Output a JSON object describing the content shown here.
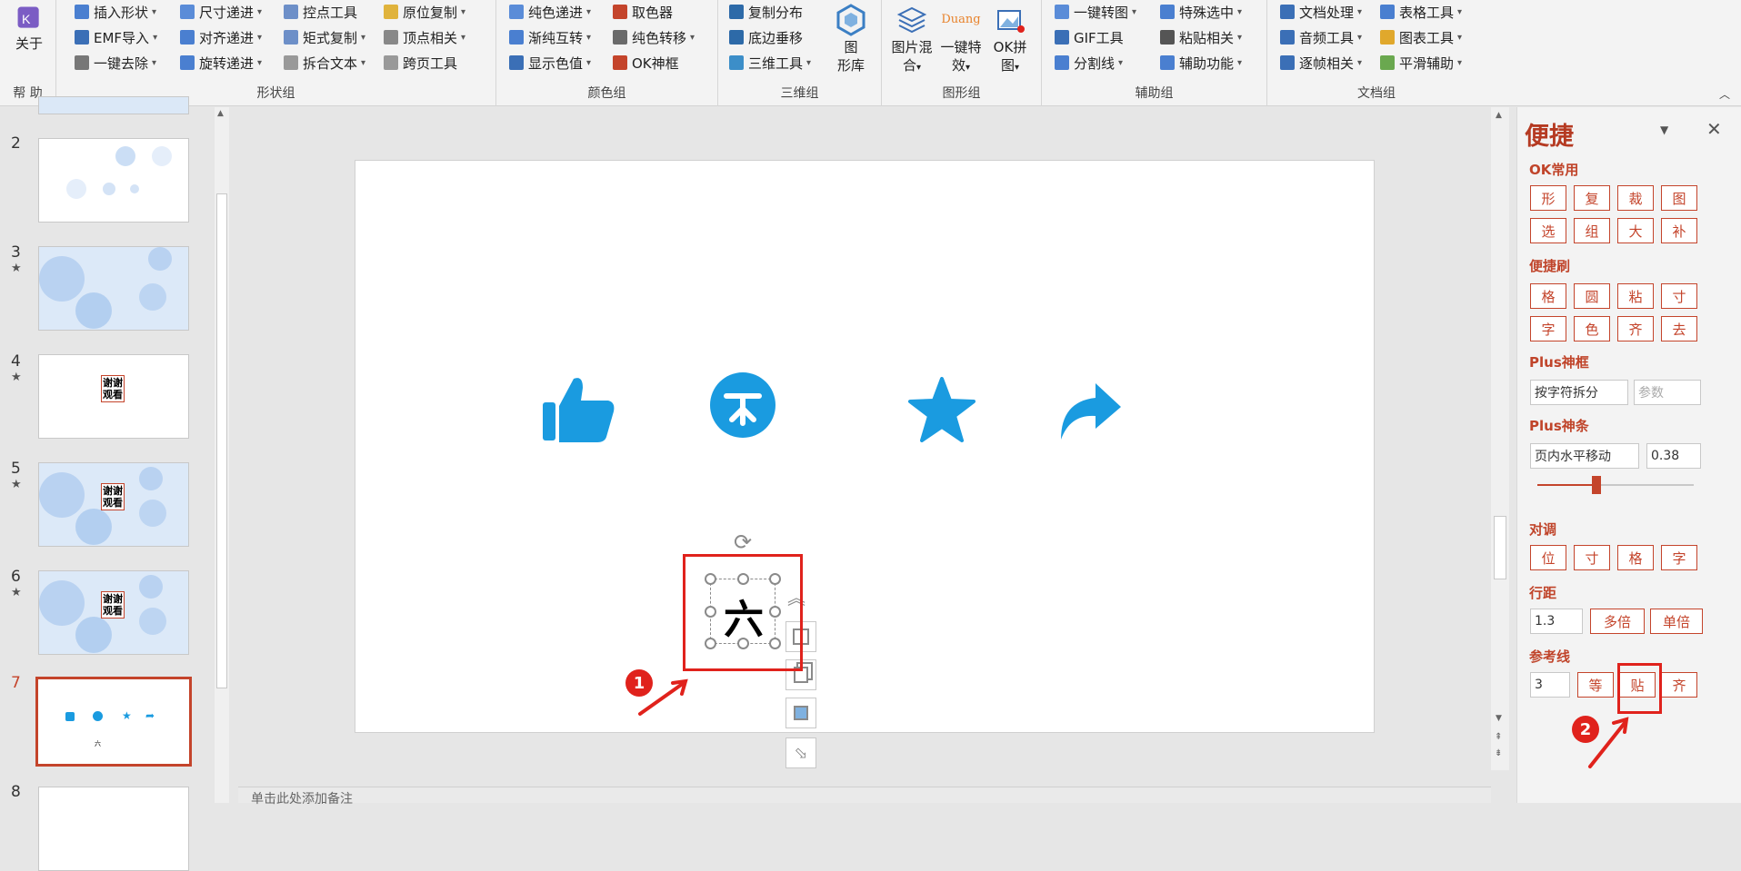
{
  "ribbon": {
    "help": {
      "btn": "关于",
      "label": "帮 助"
    },
    "shape": {
      "label": "形状组",
      "items": [
        "插入形状",
        "尺寸递进",
        "控点工具",
        "原位复制",
        "EMF导入",
        "对齐递进",
        "矩式复制",
        "顶点相关",
        "一键去除",
        "旋转递进",
        "拆合文本",
        "跨页工具"
      ]
    },
    "color": {
      "label": "颜色组",
      "items": [
        "纯色递进",
        "取色器",
        "渐纯互转",
        "纯色转移",
        "显示色值",
        "OK神框"
      ]
    },
    "threed": {
      "label": "三维组",
      "items": [
        "复制分布",
        "底边垂移",
        "三维工具"
      ],
      "big": [
        "图",
        "形库"
      ]
    },
    "graphic": {
      "label": "图形组",
      "big1": [
        "图片混",
        "合"
      ],
      "big2": [
        "一键特",
        "效"
      ],
      "big3": [
        "OK拼",
        "图"
      ],
      "duang": "Duang"
    },
    "aux": {
      "label": "辅助组",
      "items": [
        "一键转图",
        "特殊选中",
        "GIF工具",
        "粘贴相关",
        "分割线",
        "辅助功能"
      ]
    },
    "doc": {
      "label": "文档组",
      "items": [
        "文档处理",
        "表格工具",
        "音频工具",
        "图表工具",
        "逐帧相关",
        "平滑辅助"
      ]
    }
  },
  "thumbs": [
    {
      "num": "2",
      "star": ""
    },
    {
      "num": "3",
      "star": "★"
    },
    {
      "num": "4",
      "star": "★"
    },
    {
      "num": "5",
      "star": "★"
    },
    {
      "num": "6",
      "star": "★"
    },
    {
      "num": "7",
      "star": ""
    },
    {
      "num": "8",
      "star": ""
    }
  ],
  "thumb_text": {
    "xiexie": "谢谢",
    "guankan": "观看",
    "liu": "六"
  },
  "slide": {
    "char": "六"
  },
  "notes": "单击此处添加备注",
  "pane": {
    "title": "便捷",
    "sec1": "OK常用",
    "row1": [
      "形",
      "复",
      "裁",
      "图"
    ],
    "row2": [
      "选",
      "组",
      "大",
      "补"
    ],
    "sec2": "便捷刷",
    "row3": [
      "格",
      "圆",
      "粘",
      "寸"
    ],
    "row4": [
      "字",
      "色",
      "齐",
      "去"
    ],
    "sec3": "Plus神框",
    "split": "按字符拆分",
    "param": "参数",
    "sec4": "Plus神条",
    "move": "页内水平移动",
    "moveval": "0.38",
    "slider": 0.38,
    "sec5": "对调",
    "row5": [
      "位",
      "寸",
      "格",
      "字"
    ],
    "sec6": "行距",
    "linesp": "1.3",
    "multi": "多倍",
    "single": "单倍",
    "sec7": "参考线",
    "guide": "3",
    "eq": "等",
    "paste": "贴",
    "align": "齐"
  },
  "callouts": [
    "1",
    "2"
  ],
  "colors": {
    "accent": "#c4442b",
    "icon": "#1a9be0",
    "callout": "#e0221c"
  }
}
